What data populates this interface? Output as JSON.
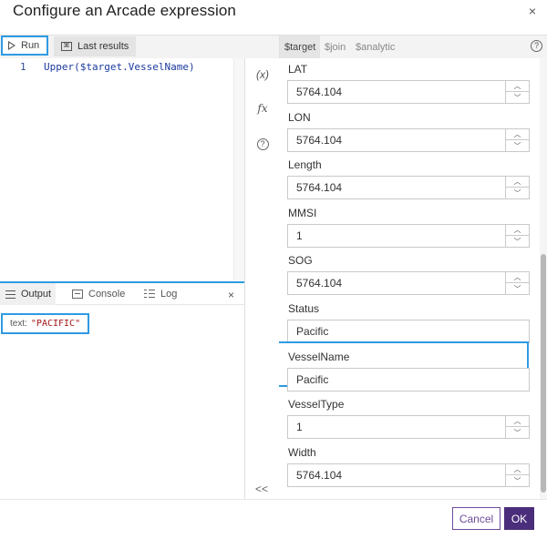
{
  "dialog": {
    "title": "Configure an Arcade expression",
    "close_glyph": "×"
  },
  "toolbar": {
    "run_label": "Run",
    "last_results_label": "Last results"
  },
  "editor": {
    "line_number": "1",
    "code": "Upper($target.VesselName)"
  },
  "side_icons": {
    "variables": "(x)",
    "functions": "fx",
    "help": "?",
    "collapse": "<<"
  },
  "output": {
    "tabs": [
      "Output",
      "Console",
      "Log"
    ],
    "result_key": "text:",
    "result_value": "\"PACIFIC\""
  },
  "profile_tabs": [
    "$target",
    "$join",
    "$analytic"
  ],
  "fields": [
    {
      "label": "LAT",
      "value": "5764.104",
      "stepper": true
    },
    {
      "label": "LON",
      "value": "5764.104",
      "stepper": true
    },
    {
      "label": "Length",
      "value": "5764.104",
      "stepper": true
    },
    {
      "label": "MMSI",
      "value": "1",
      "stepper": true
    },
    {
      "label": "SOG",
      "value": "5764.104",
      "stepper": true
    },
    {
      "label": "Status",
      "value": "Pacific",
      "stepper": false
    },
    {
      "label": "VesselName",
      "value": "Pacific",
      "stepper": false,
      "highlight": true
    },
    {
      "label": "VesselType",
      "value": "1",
      "stepper": true
    },
    {
      "label": "Width",
      "value": "5764.104",
      "stepper": true
    }
  ],
  "footer": {
    "cancel_label": "Cancel",
    "ok_label": "OK"
  },
  "colors": {
    "accent_blue": "#2e9be2",
    "brand_purple": "#4b2e7b",
    "code_blue": "#1a3a9e",
    "string_red": "#a31515"
  }
}
